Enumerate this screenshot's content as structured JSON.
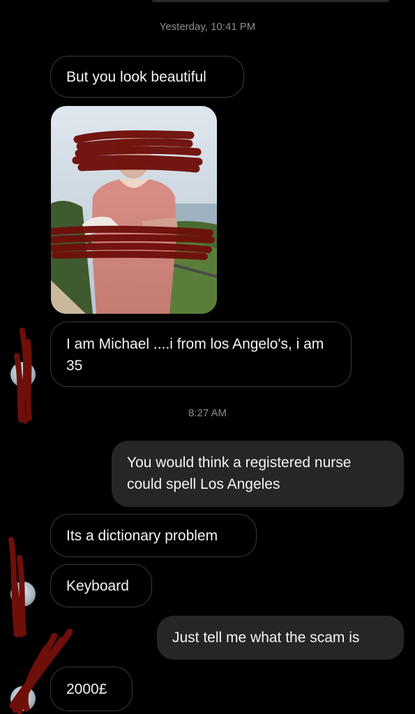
{
  "thread": {
    "timestamp_1": "Yesterday, 10:41 PM",
    "timestamp_2": "8:27 AM"
  },
  "messages": [
    {
      "sender": "them",
      "text": "But you look beautiful"
    },
    {
      "sender": "them",
      "type": "photo",
      "content": "photo of a man in pink scrubs outdoors, face and arm redacted with red scribbles"
    },
    {
      "sender": "them",
      "text": "I am Michael ....i from los Angelo's, i am 35"
    },
    {
      "sender": "me",
      "text": "You would think a registered nurse could spell Los Angeles"
    },
    {
      "sender": "them",
      "text": "Its a dictionary problem"
    },
    {
      "sender": "them",
      "text": "Keyboard"
    },
    {
      "sender": "me",
      "text": "Just tell me what the scam is"
    },
    {
      "sender": "them",
      "text": "2000£"
    }
  ],
  "theme": {
    "background": "#000000",
    "incoming_border": "#3a3a3a",
    "outgoing_bubble": "#262626",
    "timestamp_color": "#8e8e8e",
    "redaction_color": "#6e0f0a"
  }
}
